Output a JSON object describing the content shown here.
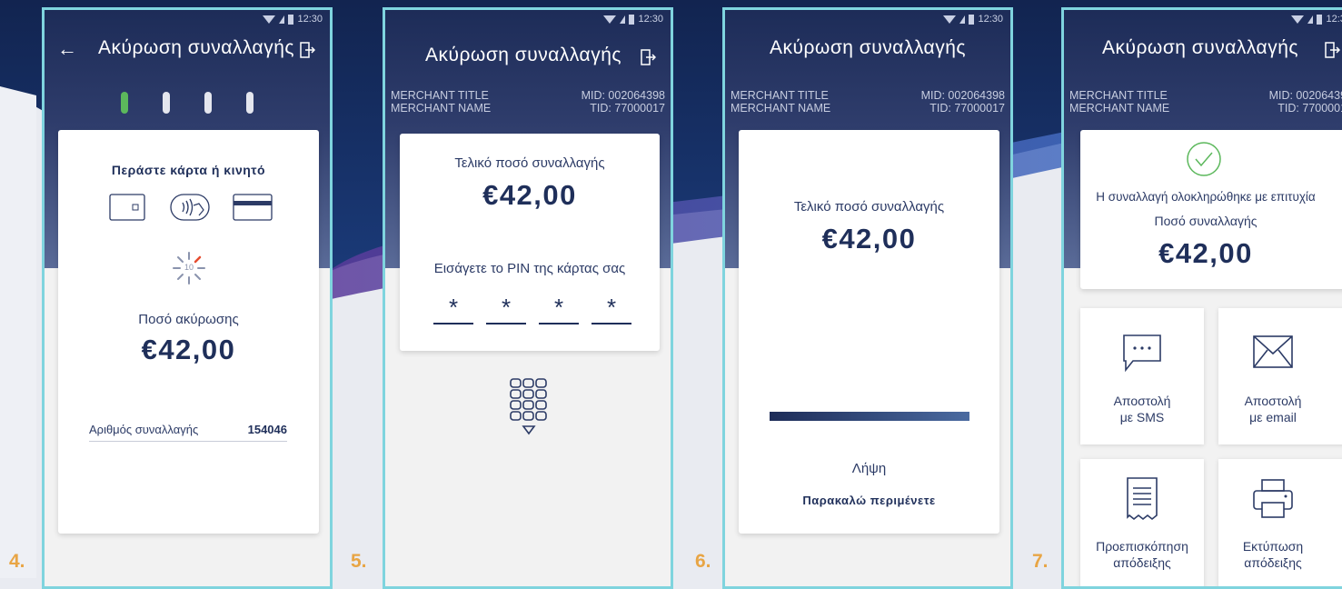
{
  "status_time": "12:30",
  "common": {
    "screen_title": "Ακύρωση συναλλαγής",
    "merchant_title": "MERCHANT TITLE",
    "merchant_name": "MERCHANT NAME",
    "mid": "MID: 002064398",
    "tid": "TID: 77000017"
  },
  "screen4": {
    "step": "4.",
    "prompt": "Περάστε κάρτα ή κινητό",
    "countdown": "10",
    "amount_label": "Ποσό ακύρωσης",
    "amount": "€42,00",
    "txn_label": "Αριθμός συναλλαγής",
    "txn_value": "154046"
  },
  "screen5": {
    "step": "5.",
    "final_label": "Τελικό ποσό συναλλαγής",
    "amount": "€42,00",
    "pin_label": "Εισάγετε το PIN της κάρτας σας",
    "pin_chars": [
      "*",
      "*",
      "*",
      "*"
    ]
  },
  "screen6": {
    "step": "6.",
    "final_label": "Τελικό ποσό συναλλαγής",
    "amount": "€42,00",
    "progress": 1.0,
    "receive_label": "Λήψη",
    "wait_label": "Παρακαλώ περιμένετε"
  },
  "screen7": {
    "step": "7.",
    "success_text": "Η συναλλαγή ολοκληρώθηκε με επιτυχία",
    "amount_label": "Ποσό συναλλαγής",
    "amount": "€42,00",
    "sms_label_1": "Αποστολή",
    "sms_label_2": "με SMS",
    "email_label_1": "Αποστολή",
    "email_label_2": "με email",
    "preview_label_1": "Προεπισκόπηση",
    "preview_label_2": "απόδειξης",
    "print_label_1": "Εκτύπωση",
    "print_label_2": "απόδειξης"
  },
  "colors": {
    "accent_green": "#5cb85c",
    "step_number": "#e8a545",
    "frame_border": "#7fd4de",
    "dark_navy": "#1d2c58"
  }
}
